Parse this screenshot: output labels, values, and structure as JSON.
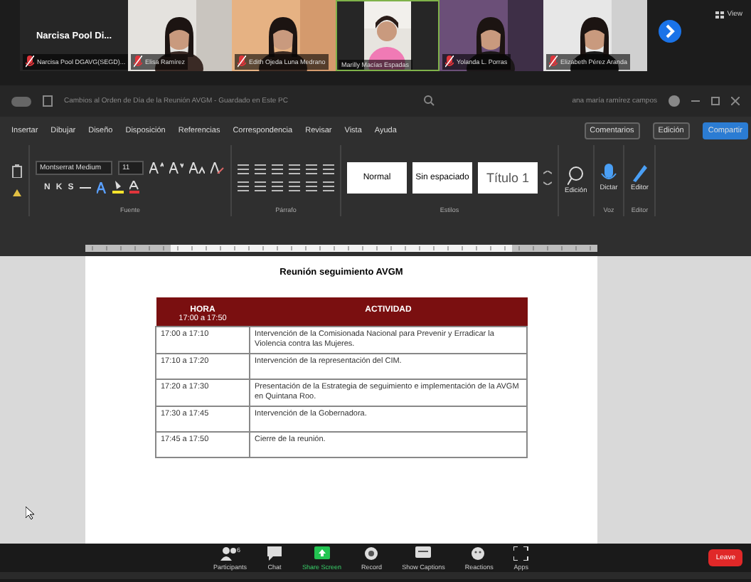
{
  "meeting": {
    "view_label": "View",
    "tiles": [
      {
        "kind": "avatar",
        "display_name": "Narcisa Pool Di...",
        "label": "Narcisa Pool DGAVG(SEGD)...",
        "muted": true,
        "speaking": false
      },
      {
        "kind": "video",
        "label": "Elisa Ramírez",
        "muted": true,
        "speaking": false
      },
      {
        "kind": "video",
        "label": "Edith Ojeda Luna Medrano",
        "muted": true,
        "speaking": false
      },
      {
        "kind": "video",
        "label": "Marilly Macías Espadas",
        "muted": false,
        "speaking": true
      },
      {
        "kind": "video",
        "label": "Yolanda L. Porras",
        "muted": true,
        "speaking": false
      },
      {
        "kind": "video",
        "label": "Elizabeth Pérez Aranda",
        "muted": true,
        "speaking": false
      }
    ]
  },
  "word": {
    "autosave_on": false,
    "title": "Cambios al Orden de Día de la Reunión AVGM - Guardado en Este PC",
    "user": "ana maría ramírez campos",
    "tabs": [
      "Insertar",
      "Dibujar",
      "Diseño",
      "Disposición",
      "Referencias",
      "Correspondencia",
      "Revisar",
      "Vista",
      "Ayuda"
    ],
    "comments_button": "Comentarios",
    "editing_button": "Edición",
    "share_button": "Compartir",
    "font_name": "Montserrat Medium",
    "font_size": "11",
    "format_letters": [
      "N",
      "K",
      "S"
    ],
    "styles": [
      "Normal",
      "Sin espaciado",
      "Título 1"
    ],
    "big_buttons": [
      "Edición",
      "Dictar",
      "Editor"
    ],
    "groups": [
      {
        "label": "Fuente",
        "kind": "font"
      },
      {
        "label": "Párrafo",
        "kind": "paragraph"
      },
      {
        "label": "Estilos",
        "kind": "styles"
      },
      {
        "label": "Voz",
        "kind": "voice"
      },
      {
        "label": "Editor",
        "kind": "editor"
      }
    ]
  },
  "document": {
    "title": "Reunión seguimiento AVGM",
    "columns": [
      {
        "label": "HORA",
        "sub": "17:00 a 17:50"
      },
      {
        "label": "ACTIVIDAD"
      }
    ],
    "rows": [
      {
        "time": "17:00 a 17:10",
        "activity": "Intervención de la Comisionada Nacional para Prevenir y Erradicar la Violencia contra las Mujeres."
      },
      {
        "time": "17:10 a 17:20",
        "activity": "Intervención de la representación del CIM."
      },
      {
        "time": "17:20 a 17:30",
        "activity": "Presentación de la Estrategia de seguimiento e implementación de la AVGM en Quintana Roo."
      },
      {
        "time": "17:30 a 17:45",
        "activity": "Intervención de la Gobernadora."
      },
      {
        "time": "17:45 a 17:50",
        "activity": "Cierre de la reunión."
      }
    ]
  },
  "toolbar": {
    "items": [
      {
        "kind": "participants",
        "label": "Participants",
        "count": "6"
      },
      {
        "kind": "chat",
        "label": "Chat"
      },
      {
        "kind": "share",
        "label": "Share Screen"
      },
      {
        "kind": "record",
        "label": "Record"
      },
      {
        "kind": "captions",
        "label": "Show Captions"
      },
      {
        "kind": "reactions",
        "label": "Reactions"
      },
      {
        "kind": "apps",
        "label": "Apps"
      }
    ],
    "leave_button": "Leave"
  }
}
